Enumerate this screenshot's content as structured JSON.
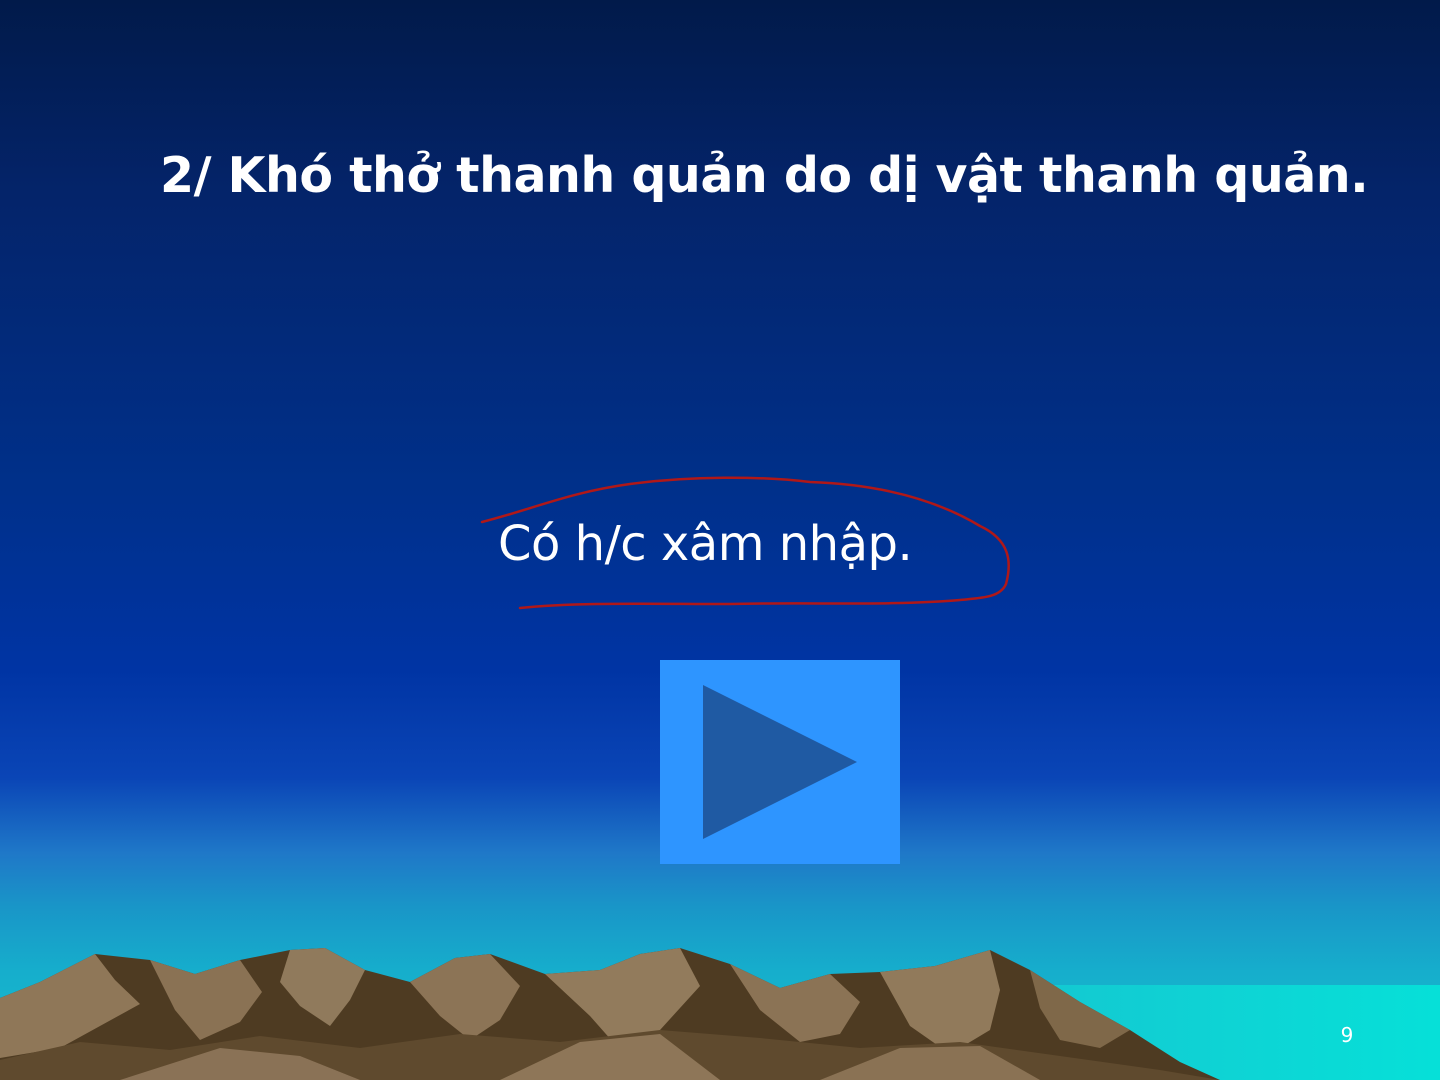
{
  "slide": {
    "title": "2/ Khó thở thanh quản do dị vật thanh quản.",
    "body_text": "Có h/c xâm nhập.",
    "slide_number": "9",
    "annotation_color": "#b01818",
    "play_button": {
      "icon": "play-icon",
      "background_color": "#2e95ff",
      "icon_color": "#1f5aa3"
    }
  },
  "background": {
    "top_color": "#011a4a",
    "middle_color": "#0034a4",
    "horizon_color": "#16aecc",
    "sea_color": "#06e0d8",
    "mountain_color": "#8a7258"
  }
}
